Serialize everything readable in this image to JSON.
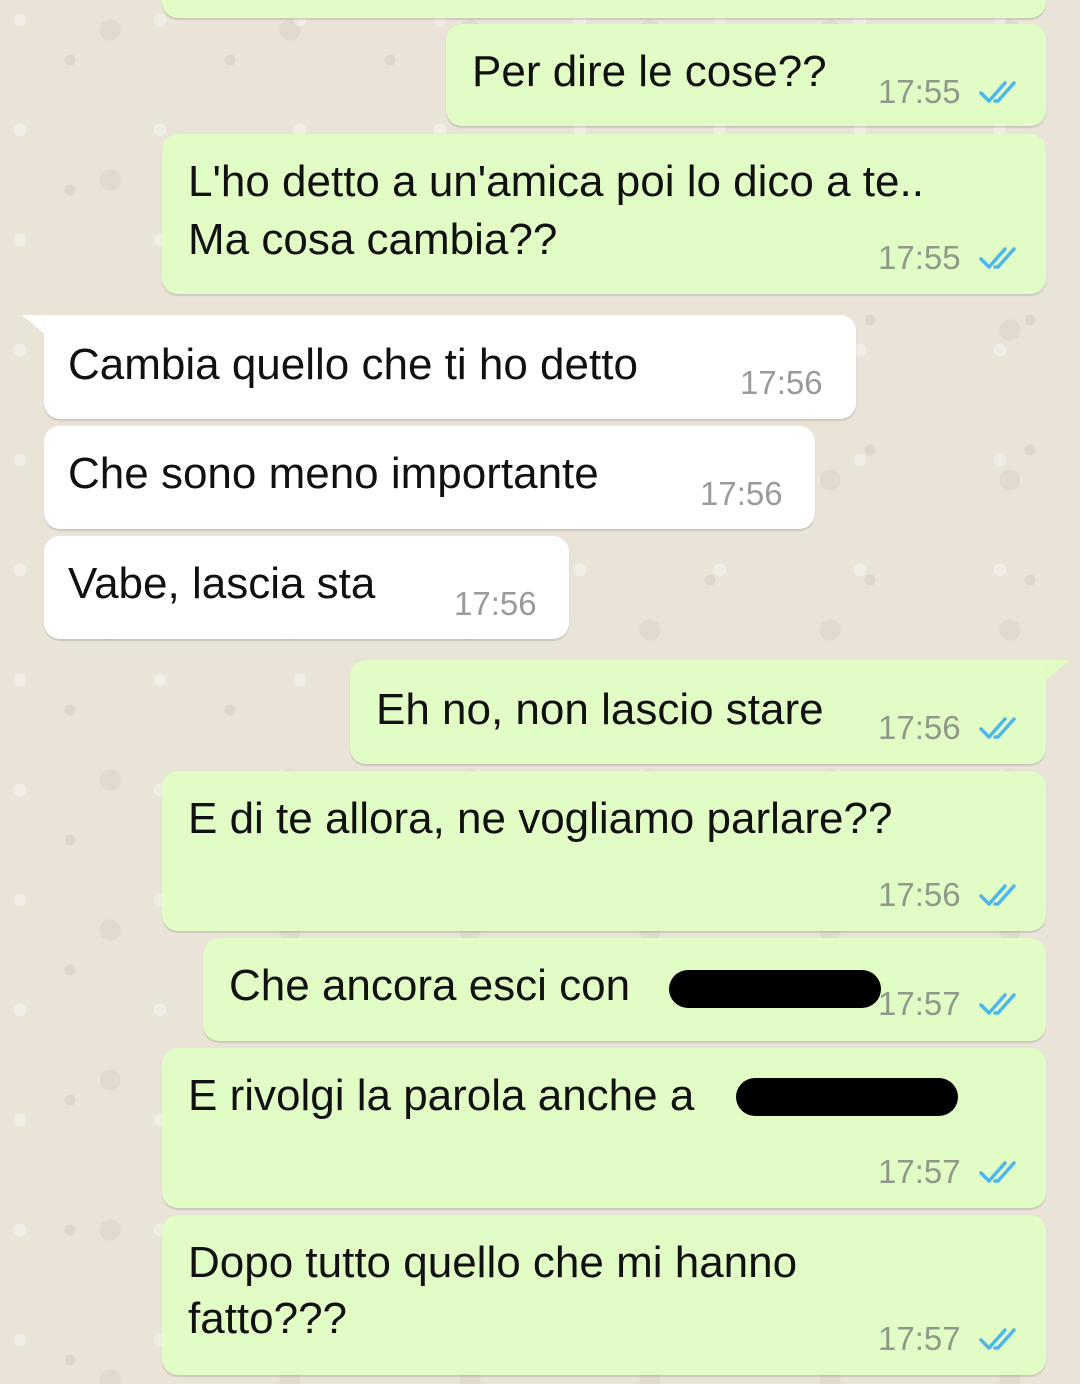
{
  "messages": [
    {
      "text": "Per dire le cose??",
      "time": "17:55",
      "dir": "out"
    },
    {
      "text": "L'ho detto a un'amica poi lo dico a te..",
      "text2": "Ma cosa cambia??",
      "time": "17:55",
      "dir": "out"
    },
    {
      "text": "Cambia quello che ti ho detto",
      "time": "17:56",
      "dir": "in"
    },
    {
      "text": "Che sono meno importante",
      "time": "17:56",
      "dir": "in"
    },
    {
      "text": "Vabe, lascia sta",
      "time": "17:56",
      "dir": "in"
    },
    {
      "text": "Eh no, non lascio stare",
      "time": "17:56",
      "dir": "out"
    },
    {
      "text": "E di te allora, ne vogliamo parlare??",
      "time": "17:56",
      "dir": "out"
    },
    {
      "text": "Che ancora esci con",
      "time": "17:57",
      "dir": "out"
    },
    {
      "text": "E rivolgi la parola anche a",
      "time": "17:57",
      "dir": "out"
    },
    {
      "text": "Dopo tutto quello che mi hanno",
      "text2": "fatto???",
      "time": "17:57",
      "dir": "out"
    }
  ],
  "colors": {
    "outgoing_bubble": "#e2fcc5",
    "incoming_bubble": "#ffffff",
    "read_ticks": "#4fb6ec",
    "wallpaper": "#e9e3d8"
  },
  "icons": {
    "read_receipt": "double-check-icon"
  }
}
